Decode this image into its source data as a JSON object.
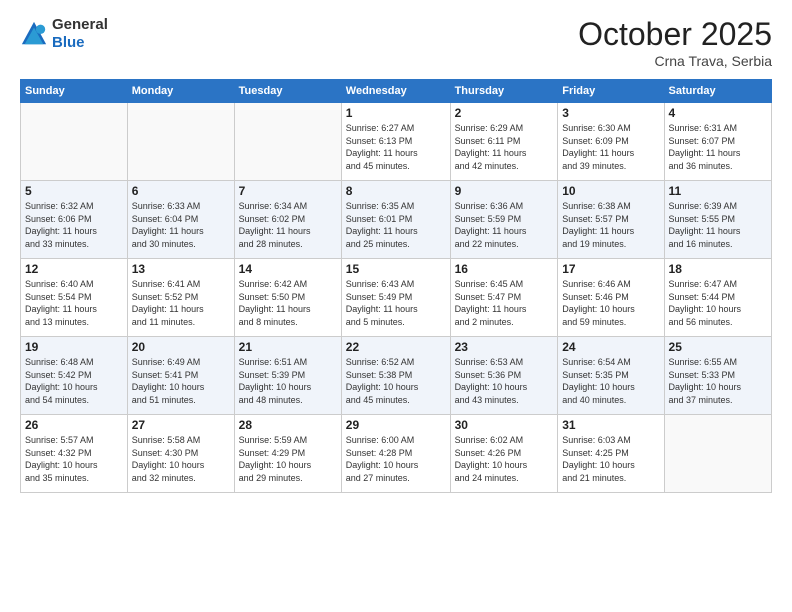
{
  "header": {
    "logo_general": "General",
    "logo_blue": "Blue",
    "month": "October 2025",
    "location": "Crna Trava, Serbia"
  },
  "days_of_week": [
    "Sunday",
    "Monday",
    "Tuesday",
    "Wednesday",
    "Thursday",
    "Friday",
    "Saturday"
  ],
  "weeks": [
    [
      {
        "day": "",
        "info": ""
      },
      {
        "day": "",
        "info": ""
      },
      {
        "day": "",
        "info": ""
      },
      {
        "day": "1",
        "info": "Sunrise: 6:27 AM\nSunset: 6:13 PM\nDaylight: 11 hours\nand 45 minutes."
      },
      {
        "day": "2",
        "info": "Sunrise: 6:29 AM\nSunset: 6:11 PM\nDaylight: 11 hours\nand 42 minutes."
      },
      {
        "day": "3",
        "info": "Sunrise: 6:30 AM\nSunset: 6:09 PM\nDaylight: 11 hours\nand 39 minutes."
      },
      {
        "day": "4",
        "info": "Sunrise: 6:31 AM\nSunset: 6:07 PM\nDaylight: 11 hours\nand 36 minutes."
      }
    ],
    [
      {
        "day": "5",
        "info": "Sunrise: 6:32 AM\nSunset: 6:06 PM\nDaylight: 11 hours\nand 33 minutes."
      },
      {
        "day": "6",
        "info": "Sunrise: 6:33 AM\nSunset: 6:04 PM\nDaylight: 11 hours\nand 30 minutes."
      },
      {
        "day": "7",
        "info": "Sunrise: 6:34 AM\nSunset: 6:02 PM\nDaylight: 11 hours\nand 28 minutes."
      },
      {
        "day": "8",
        "info": "Sunrise: 6:35 AM\nSunset: 6:01 PM\nDaylight: 11 hours\nand 25 minutes."
      },
      {
        "day": "9",
        "info": "Sunrise: 6:36 AM\nSunset: 5:59 PM\nDaylight: 11 hours\nand 22 minutes."
      },
      {
        "day": "10",
        "info": "Sunrise: 6:38 AM\nSunset: 5:57 PM\nDaylight: 11 hours\nand 19 minutes."
      },
      {
        "day": "11",
        "info": "Sunrise: 6:39 AM\nSunset: 5:55 PM\nDaylight: 11 hours\nand 16 minutes."
      }
    ],
    [
      {
        "day": "12",
        "info": "Sunrise: 6:40 AM\nSunset: 5:54 PM\nDaylight: 11 hours\nand 13 minutes."
      },
      {
        "day": "13",
        "info": "Sunrise: 6:41 AM\nSunset: 5:52 PM\nDaylight: 11 hours\nand 11 minutes."
      },
      {
        "day": "14",
        "info": "Sunrise: 6:42 AM\nSunset: 5:50 PM\nDaylight: 11 hours\nand 8 minutes."
      },
      {
        "day": "15",
        "info": "Sunrise: 6:43 AM\nSunset: 5:49 PM\nDaylight: 11 hours\nand 5 minutes."
      },
      {
        "day": "16",
        "info": "Sunrise: 6:45 AM\nSunset: 5:47 PM\nDaylight: 11 hours\nand 2 minutes."
      },
      {
        "day": "17",
        "info": "Sunrise: 6:46 AM\nSunset: 5:46 PM\nDaylight: 10 hours\nand 59 minutes."
      },
      {
        "day": "18",
        "info": "Sunrise: 6:47 AM\nSunset: 5:44 PM\nDaylight: 10 hours\nand 56 minutes."
      }
    ],
    [
      {
        "day": "19",
        "info": "Sunrise: 6:48 AM\nSunset: 5:42 PM\nDaylight: 10 hours\nand 54 minutes."
      },
      {
        "day": "20",
        "info": "Sunrise: 6:49 AM\nSunset: 5:41 PM\nDaylight: 10 hours\nand 51 minutes."
      },
      {
        "day": "21",
        "info": "Sunrise: 6:51 AM\nSunset: 5:39 PM\nDaylight: 10 hours\nand 48 minutes."
      },
      {
        "day": "22",
        "info": "Sunrise: 6:52 AM\nSunset: 5:38 PM\nDaylight: 10 hours\nand 45 minutes."
      },
      {
        "day": "23",
        "info": "Sunrise: 6:53 AM\nSunset: 5:36 PM\nDaylight: 10 hours\nand 43 minutes."
      },
      {
        "day": "24",
        "info": "Sunrise: 6:54 AM\nSunset: 5:35 PM\nDaylight: 10 hours\nand 40 minutes."
      },
      {
        "day": "25",
        "info": "Sunrise: 6:55 AM\nSunset: 5:33 PM\nDaylight: 10 hours\nand 37 minutes."
      }
    ],
    [
      {
        "day": "26",
        "info": "Sunrise: 5:57 AM\nSunset: 4:32 PM\nDaylight: 10 hours\nand 35 minutes."
      },
      {
        "day": "27",
        "info": "Sunrise: 5:58 AM\nSunset: 4:30 PM\nDaylight: 10 hours\nand 32 minutes."
      },
      {
        "day": "28",
        "info": "Sunrise: 5:59 AM\nSunset: 4:29 PM\nDaylight: 10 hours\nand 29 minutes."
      },
      {
        "day": "29",
        "info": "Sunrise: 6:00 AM\nSunset: 4:28 PM\nDaylight: 10 hours\nand 27 minutes."
      },
      {
        "day": "30",
        "info": "Sunrise: 6:02 AM\nSunset: 4:26 PM\nDaylight: 10 hours\nand 24 minutes."
      },
      {
        "day": "31",
        "info": "Sunrise: 6:03 AM\nSunset: 4:25 PM\nDaylight: 10 hours\nand 21 minutes."
      },
      {
        "day": "",
        "info": ""
      }
    ]
  ]
}
